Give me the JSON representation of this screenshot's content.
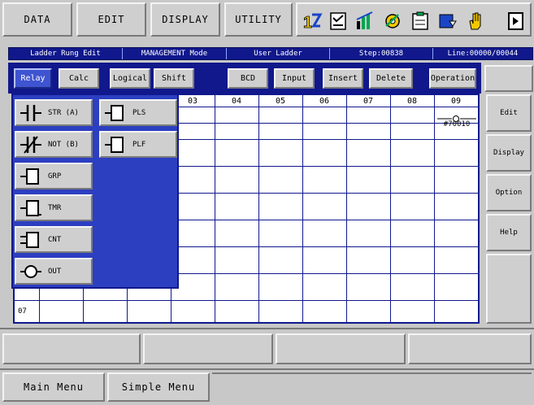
{
  "top_menu": {
    "items": [
      "DATA",
      "EDIT",
      "DISPLAY",
      "UTILITY"
    ]
  },
  "toolbar_icons": [
    "sort-icon",
    "checklist-icon",
    "chart-icon",
    "gear-icon",
    "clipboard-icon",
    "download-icon",
    "hand-icon",
    "exit-icon"
  ],
  "status_bar": {
    "mode": "Ladder Rung Edit",
    "security": "MANAGEMENT Mode",
    "program": "User Ladder",
    "step": "Step:00838",
    "line": "Line:00000/00044"
  },
  "tabs": [
    "Relay",
    "Calc",
    "Logical",
    "Shift",
    "BCD",
    "Input",
    "Insert",
    "Delete",
    "Operation"
  ],
  "grid": {
    "col_headers": [
      "03",
      "04",
      "05",
      "06",
      "07",
      "08",
      "09"
    ],
    "row_label": "07",
    "cell_value": "#70010"
  },
  "instructions": [
    {
      "label": "STR (A)",
      "icon": "normally-open-contact-icon"
    },
    {
      "label": "PLS",
      "icon": "pulse-rising-icon"
    },
    {
      "label": "NOT (B)",
      "icon": "normally-closed-contact-icon"
    },
    {
      "label": "PLF",
      "icon": "pulse-falling-icon"
    },
    {
      "label": "GRP",
      "icon": "group-block-icon"
    },
    {
      "label": "TMR",
      "icon": "timer-icon"
    },
    {
      "label": "CNT",
      "icon": "counter-icon"
    },
    {
      "label": "OUT",
      "icon": "output-coil-icon"
    }
  ],
  "side_menu": [
    "Edit",
    "Display",
    "Option",
    "Help"
  ],
  "bottom_menu": [
    "Main Menu",
    "Simple Menu"
  ],
  "colors": {
    "navy": "#10188c",
    "overlay": "#2c3fc1",
    "panel": "#c8c8c8",
    "icon_yellow": "#f2c900",
    "icon_green": "#00a650",
    "icon_blue": "#1a45c8"
  }
}
